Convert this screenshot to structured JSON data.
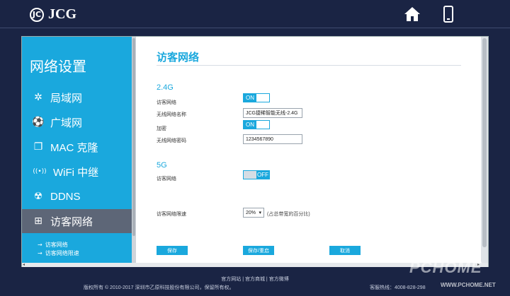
{
  "header": {
    "logo_text": "JCG",
    "logo_mark": "JC",
    "icons": {
      "home": "home-icon",
      "mobile": "mobile-icon"
    }
  },
  "sidebar": {
    "title": "网络设置",
    "items": [
      {
        "label": "局域网",
        "icon": "lan-icon",
        "glyph": "✲"
      },
      {
        "label": "广域网",
        "icon": "wan-globe-icon",
        "glyph": "⚽"
      },
      {
        "label": "MAC 克隆",
        "icon": "mac-clone-icon",
        "glyph": "❐"
      },
      {
        "label": "WiFi 中继",
        "icon": "wifi-relay-icon",
        "glyph": "((•))"
      },
      {
        "label": "DDNS",
        "icon": "ddns-icon",
        "glyph": "☢"
      },
      {
        "label": "访客网络",
        "icon": "guest-network-icon",
        "glyph": "⊞",
        "active": true
      }
    ],
    "sub_items": [
      {
        "label": "访客网络"
      },
      {
        "label": "访客网络限速"
      }
    ]
  },
  "main": {
    "title": "访客网络",
    "band24": {
      "heading": "2.4G",
      "guest_label": "访客网络",
      "guest_toggle": "ON",
      "ssid_label": "无线网络名称",
      "ssid_value": "JCG捷稀智能无线-2.4G",
      "encrypt_label": "加密",
      "encrypt_toggle": "ON",
      "password_label": "无线网络密码",
      "password_value": "1234567890"
    },
    "band5": {
      "heading": "5G",
      "guest_label": "访客网络",
      "guest_toggle": "OFF"
    },
    "speed_limit": {
      "label": "访客网络限速",
      "value": "20%",
      "hint": "(占总带宽的百分比)"
    },
    "buttons": {
      "save": "保存",
      "save_restart": "保存/重启",
      "cancel": "取消"
    }
  },
  "footer": {
    "links": "官方网站 | 官方商城 | 官方微博",
    "copyright": "版权所有 © 2010-2017 深圳市乙原科技股份有限公司，保留所有权。",
    "hotline": "客服热线：4008-828-298"
  },
  "watermark": {
    "big": "PCHOME",
    "small": "WWW.PCHOME.NET"
  },
  "colors": {
    "accent": "#1aa8dd",
    "background": "#1a2444",
    "active_item": "#5d6677"
  }
}
